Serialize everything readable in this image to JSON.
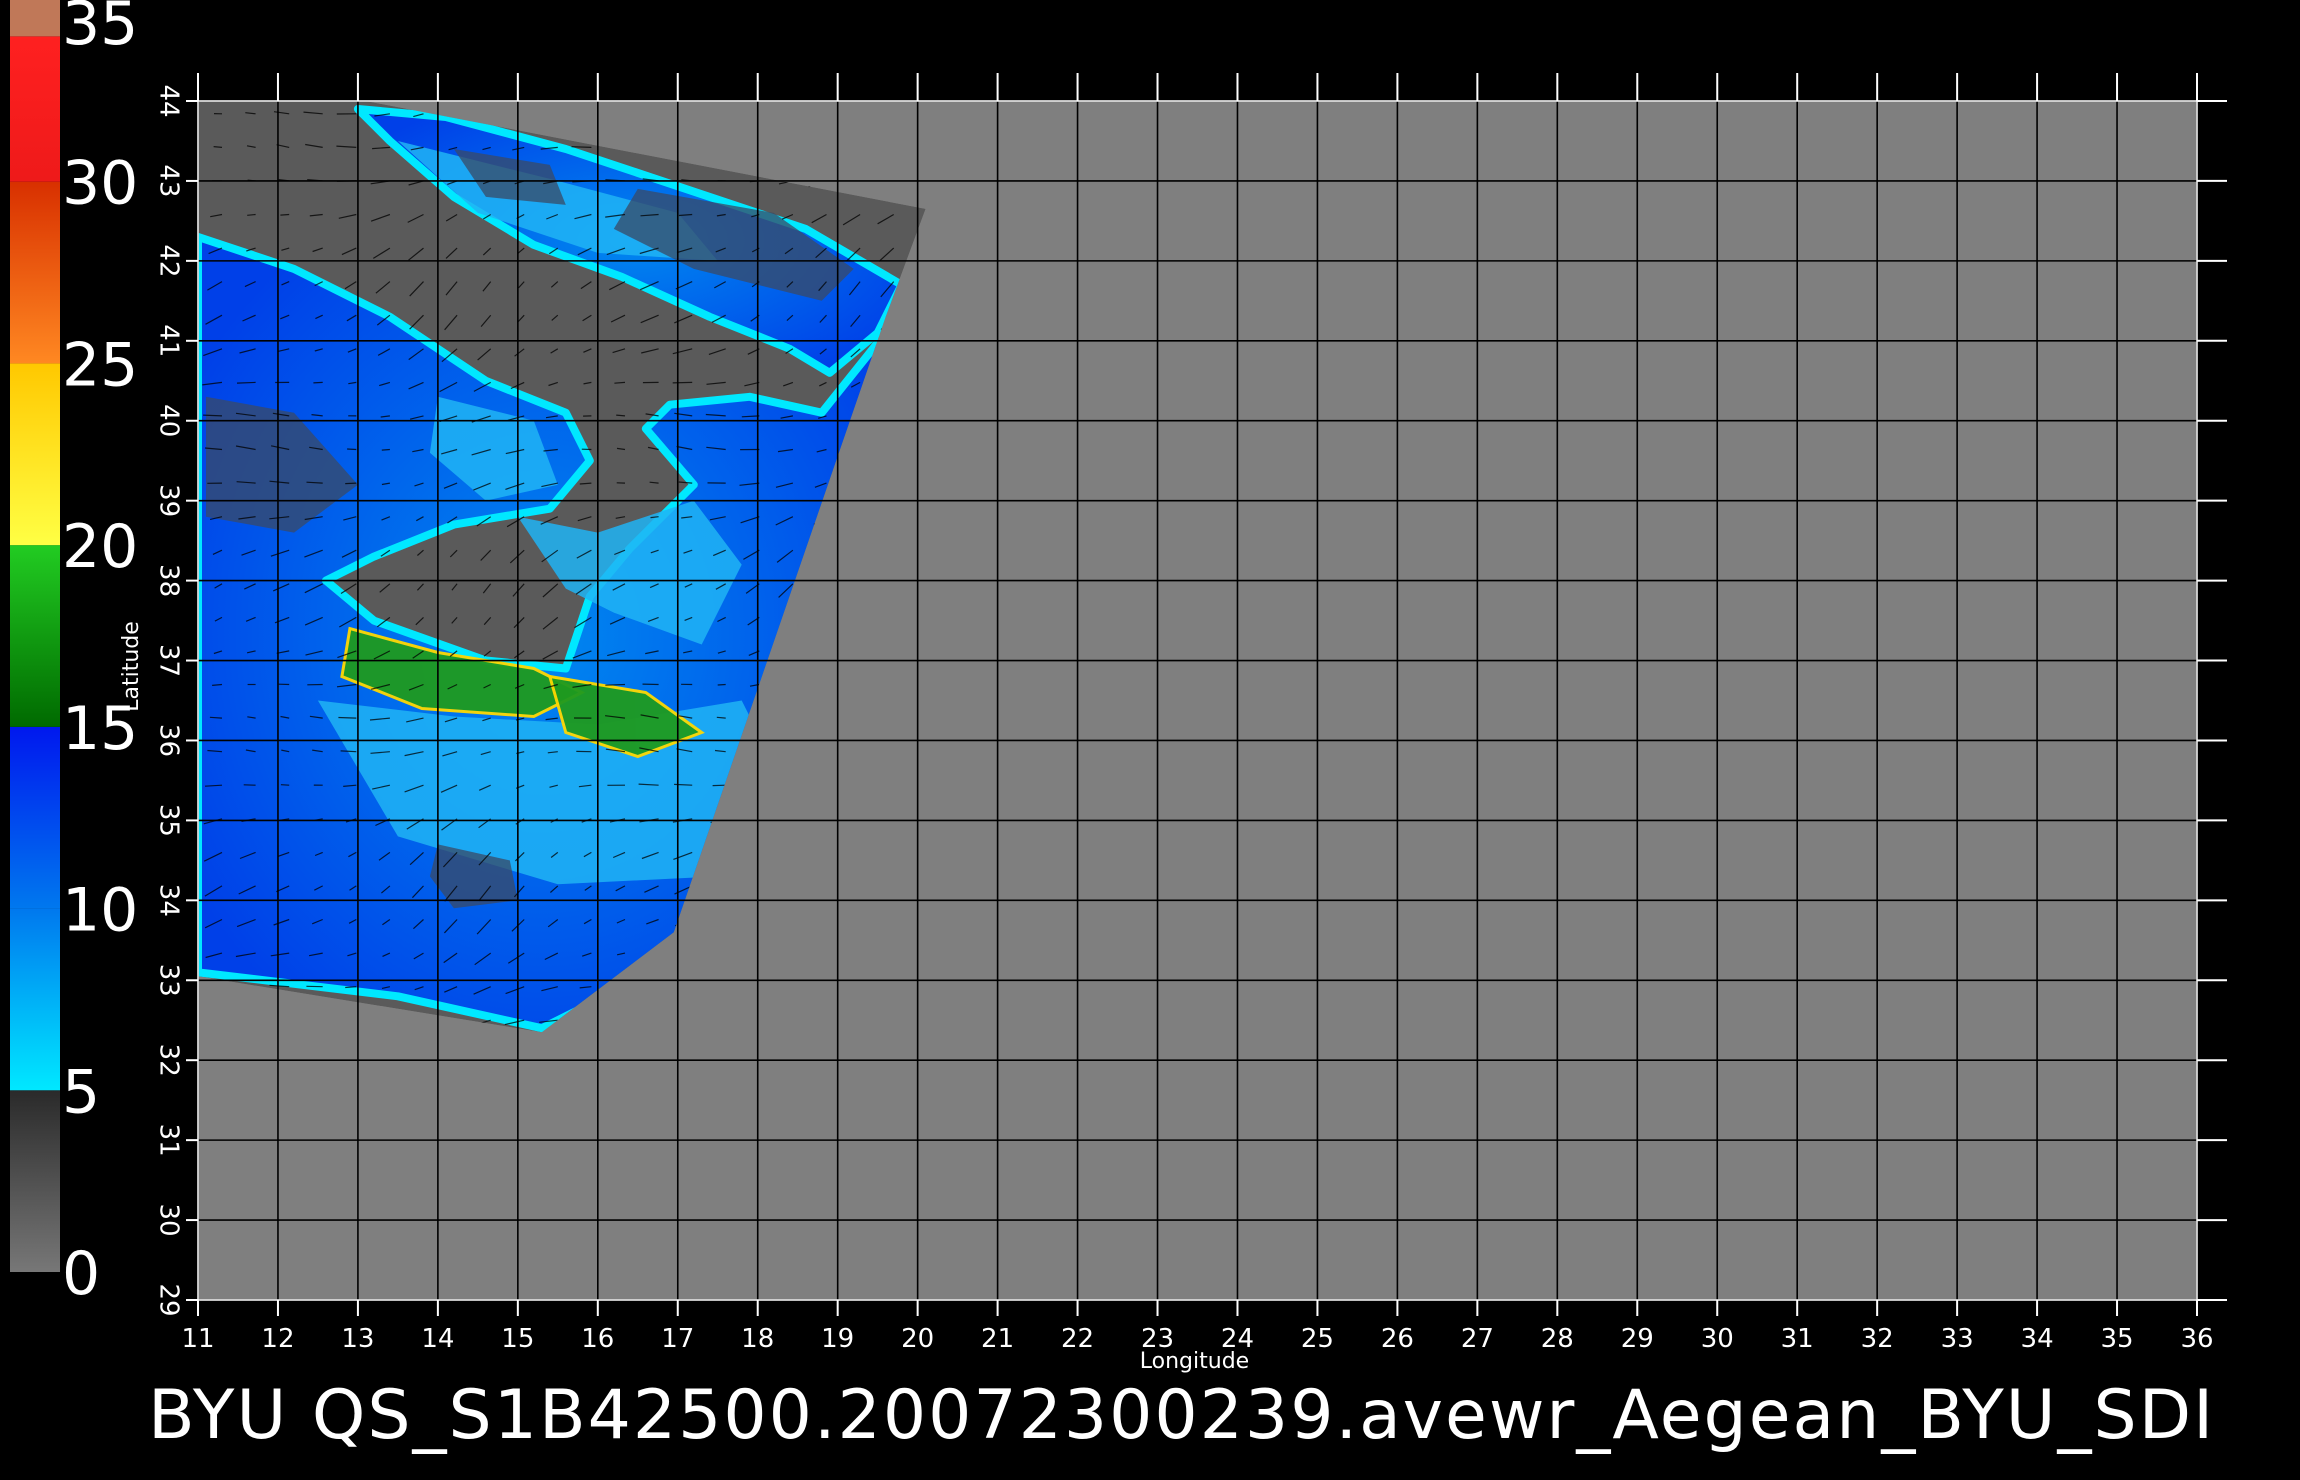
{
  "caption": "BYU  QS_S1B42500.20072300239.avewr_Aegean_BYU_SDI",
  "axes": {
    "xlabel": "Longitude",
    "ylabel": "Latitude",
    "x_ticks": [
      "11",
      "12",
      "13",
      "14",
      "15",
      "16",
      "17",
      "18",
      "19",
      "20",
      "21",
      "22",
      "23",
      "24",
      "25",
      "26",
      "27",
      "28",
      "29",
      "30",
      "31",
      "32",
      "33",
      "34",
      "35",
      "36"
    ],
    "y_ticks": [
      "29",
      "30",
      "31",
      "32",
      "33",
      "34",
      "35",
      "36",
      "37",
      "38",
      "39",
      "40",
      "41",
      "42",
      "43",
      "44"
    ],
    "xlim": [
      11,
      36
    ],
    "ylim": [
      29,
      44
    ],
    "grid": true
  },
  "colorbar": {
    "ticks": [
      "0",
      "5",
      "10",
      "15",
      "20",
      "25",
      "30",
      "35"
    ],
    "range": [
      0,
      35
    ],
    "bands": [
      {
        "from": 0,
        "to": 5,
        "color_start": "#777777",
        "color_end": "#2a2a2a"
      },
      {
        "from": 5,
        "to": 10,
        "color_start": "#00e8ff",
        "color_end": "#0078ee"
      },
      {
        "from": 10,
        "to": 15,
        "color_start": "#0078ee",
        "color_end": "#0018ee"
      },
      {
        "from": 15,
        "to": 20,
        "color_start": "#006a00",
        "color_end": "#22cc22"
      },
      {
        "from": 20,
        "to": 25,
        "color_start": "#ffff44",
        "color_end": "#ffc800"
      },
      {
        "from": 25,
        "to": 30,
        "color_start": "#ff8822",
        "color_end": "#d83000"
      },
      {
        "from": 30,
        "to": 34,
        "color_start": "#ee1a1a",
        "color_end": "#ff2020"
      },
      {
        "from": 34,
        "to": 35,
        "color_start": "#c07858",
        "color_end": "#c07858"
      }
    ]
  },
  "colors": {
    "background": "#000000",
    "plot_area": "#7f7f7f",
    "swath_land": "#5a5a5a",
    "grid": "#000000",
    "text": "#ffffff",
    "wind_low": "#00e8ff",
    "wind_mid": "#0050ee",
    "wind_high": "#1f9a1f"
  }
}
